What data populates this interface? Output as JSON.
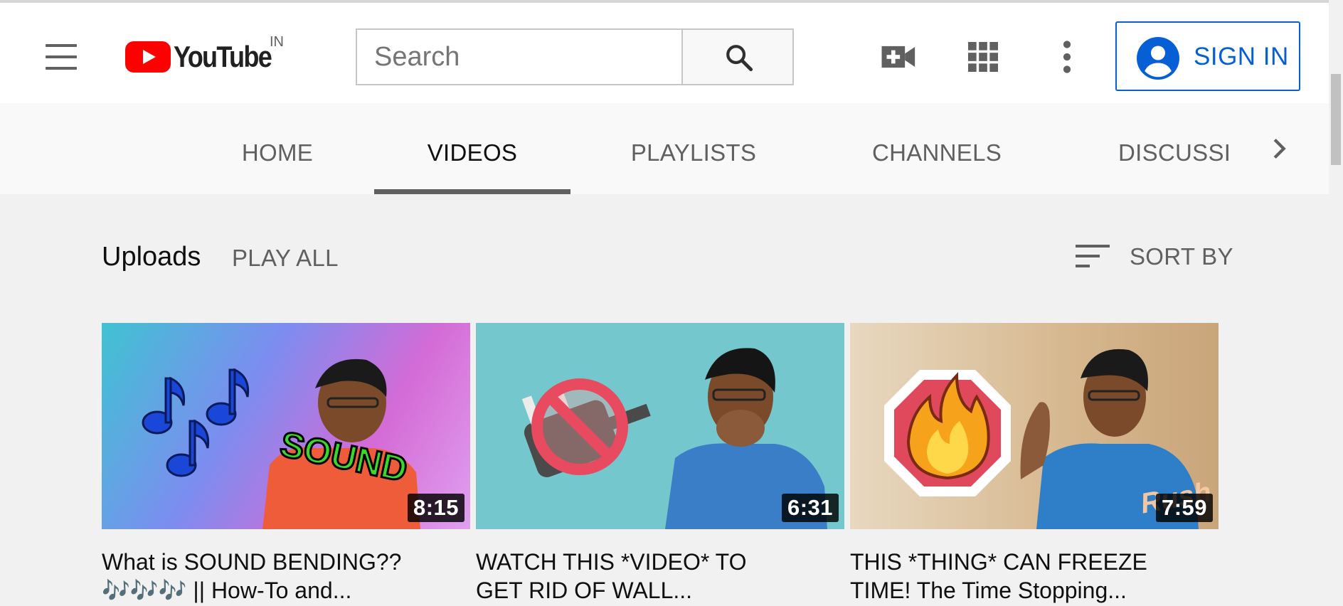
{
  "header": {
    "logo_text": "YouTube",
    "country_code": "IN",
    "search_placeholder": "Search",
    "sign_in_label": "SIGN IN"
  },
  "tabs": [
    {
      "label": "HOME",
      "active": false
    },
    {
      "label": "VIDEOS",
      "active": true
    },
    {
      "label": "PLAYLISTS",
      "active": false
    },
    {
      "label": "CHANNELS",
      "active": false
    },
    {
      "label": "DISCUSSION",
      "active": false
    }
  ],
  "section": {
    "title": "Uploads",
    "play_all_label": "PLAY ALL",
    "sort_label": "SORT BY"
  },
  "videos": [
    {
      "title_line1": "What is SOUND BENDING??",
      "title_line2_suffix": " || How-To and...",
      "title_line2_emoji": "🎶🎶🎶",
      "duration": "8:15",
      "thumb_text": "SOUND"
    },
    {
      "title_line1": "WATCH THIS *VIDEO* TO",
      "title_line2": "GET RID OF WALL...",
      "duration": "6:31"
    },
    {
      "title_line1": "THIS *THING* CAN FREEZE",
      "title_line2": "TIME! The Time Stopping...",
      "duration": "7:59"
    }
  ],
  "icons": {
    "menu": "hamburger-icon",
    "search": "search-icon",
    "create": "video-camera-plus-icon",
    "apps": "apps-grid-icon",
    "more": "more-vertical-icon",
    "account": "account-circle-icon",
    "sort": "sort-icon",
    "next": "chevron-right-icon"
  },
  "colors": {
    "brand_red": "#ff0000",
    "signin_blue": "#065fd4"
  }
}
